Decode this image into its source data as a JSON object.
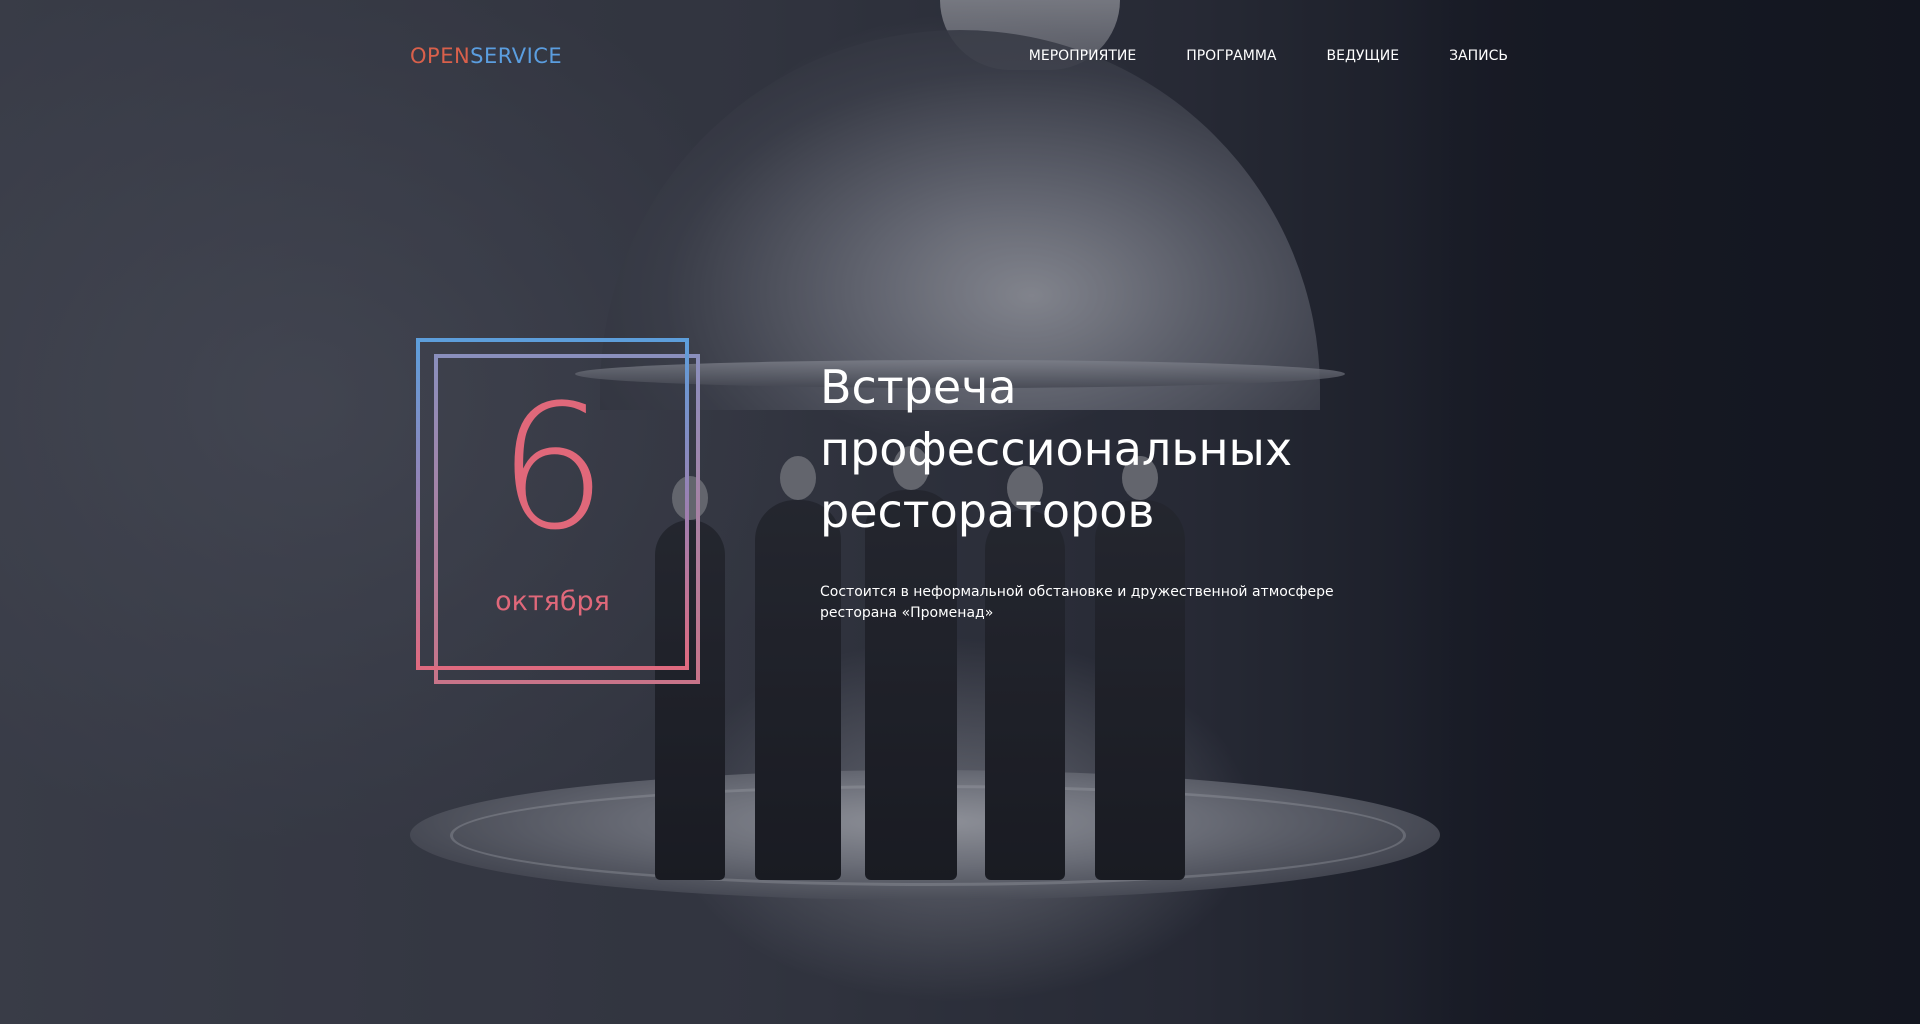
{
  "brand": {
    "logo_part1": "OPEN",
    "logo_part2": "SERVICE",
    "color_part1": "#d9604b",
    "color_part2": "#5b9ee0"
  },
  "nav": {
    "items": [
      {
        "label": "МЕРОПРИЯТИЕ"
      },
      {
        "label": "ПРОГРАММА"
      },
      {
        "label": "ВЕДУЩИЕ"
      },
      {
        "label": "ЗАПИСЬ"
      }
    ]
  },
  "event": {
    "day": "6",
    "month": "октября",
    "title_line1": "Встреча",
    "title_line2": "профессиональных",
    "title_line3": "рестораторов",
    "description_line1": "Состоится в неформальной обстановке и дружественной атмосфере",
    "description_line2": "ресторана «Променад»",
    "accent_color": "#e0687a"
  }
}
